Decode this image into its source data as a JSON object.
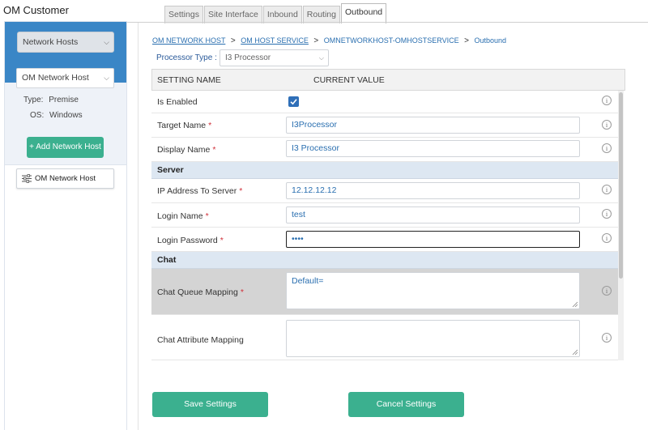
{
  "app": {
    "title": "OM Customer"
  },
  "tabs": [
    {
      "label": "Settings"
    },
    {
      "label": "Site Interface"
    },
    {
      "label": "Inbound"
    },
    {
      "label": "Routing"
    },
    {
      "label": "Outbound",
      "active": true
    }
  ],
  "sidebar": {
    "category_select": "Network Hosts",
    "host_select": "OM Network Host",
    "type_label": "Type:",
    "type_value": "Premise",
    "os_label": "OS:",
    "os_value": "Windows",
    "add_button": "+ Add Network Host",
    "host_card": "OM Network Host",
    "host_card_icon": "sliders-icon"
  },
  "breadcrumb": {
    "items": [
      "OM NETWORK HOST",
      "OM HOST SERVICE",
      "OMNETWORKHOST-OMHOSTSERVICE",
      "Outbound"
    ],
    "separator": ">"
  },
  "processor": {
    "label": "Processor Type :",
    "value": "I3 Processor"
  },
  "grid": {
    "headers": {
      "setting": "SETTING NAME",
      "value": "CURRENT VALUE"
    },
    "rows": {
      "is_enabled": {
        "label": "Is Enabled",
        "checked": true
      },
      "target_name": {
        "label": "Target Name",
        "value": "I3Processor",
        "required": "*"
      },
      "display_name": {
        "label": "Display Name",
        "value": "I3 Processor",
        "required": "*"
      },
      "ip_address": {
        "label": "IP Address To Server",
        "value": "12.12.12.12",
        "required": "*"
      },
      "login_name": {
        "label": "Login Name",
        "value": "test",
        "required": "*"
      },
      "login_password": {
        "label": "Login Password",
        "value": "••••",
        "required": "*"
      },
      "chat_queue_mapping": {
        "label": "Chat Queue Mapping",
        "value": "Default=",
        "required": "*"
      },
      "chat_attribute_mapping": {
        "label": "Chat Attribute Mapping",
        "value": ""
      }
    },
    "sections": {
      "server": "Server",
      "chat": "Chat"
    },
    "info_glyph": "i"
  },
  "actions": {
    "save": "Save Settings",
    "cancel": "Cancel Settings"
  },
  "colors": {
    "accent_blue": "#3a86c6",
    "button_green": "#3bb08f",
    "link_blue": "#2a6fb0",
    "required_red": "#d0303a",
    "section_bg": "#dde7f2"
  }
}
